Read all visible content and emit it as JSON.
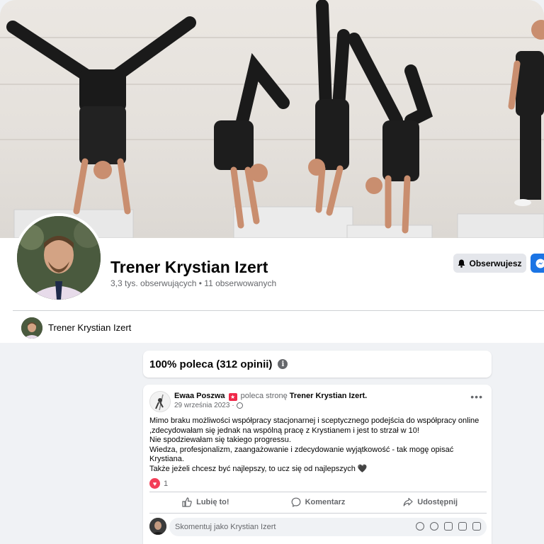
{
  "page": {
    "name": "Trener Krystian Izert",
    "followers": "3,3 tys. obserwujących",
    "separator": "•",
    "following": "11 obserwowanych",
    "follow_button": "Obserwujesz"
  },
  "nav": {
    "profile_name": "Trener Krystian Izert"
  },
  "recommendation": {
    "title": "100% poleca (312 opinii)",
    "info_glyph": "i"
  },
  "post": {
    "author": "Ewaa Poszwa",
    "recommends_text": "poleca stronę",
    "target": "Trener Krystian Izert.",
    "date": "29 września 2023",
    "date_dot": "·",
    "more": "•••",
    "body_lines": [
      "Mimo braku możliwości współpracy stacjonarnej i sceptycznego podejścia do współpracy online ,zdecydowałam się jednak na wspólną pracę z Krystianem i jest to strzał w 10!",
      "Nie spodziewałam się takiego progressu.",
      "Wiedza, profesjonalizm, zaangażowanie i zdecydowanie wyjątkowość - tak mogę opisać Krystiana.",
      "Także jeżeli chcesz być najlepszy, to ucz się od najlepszych"
    ],
    "heart_emoji": "🖤",
    "reaction_count": "1",
    "actions": {
      "like": "Lubię to!",
      "comment": "Komentarz",
      "share": "Udostępnij"
    },
    "comment_placeholder": "Skomentuj jako Krystian Izert"
  },
  "colors": {
    "accent": "#1b74e4",
    "love": "#f33e58",
    "background": "#f0f2f5"
  },
  "icons": [
    "bell-icon",
    "messenger-icon",
    "info-icon",
    "globe-icon",
    "more-icon",
    "like-icon",
    "comment-icon",
    "share-icon",
    "emoji-icon",
    "camera-icon",
    "gif-icon",
    "sticker-icon"
  ]
}
